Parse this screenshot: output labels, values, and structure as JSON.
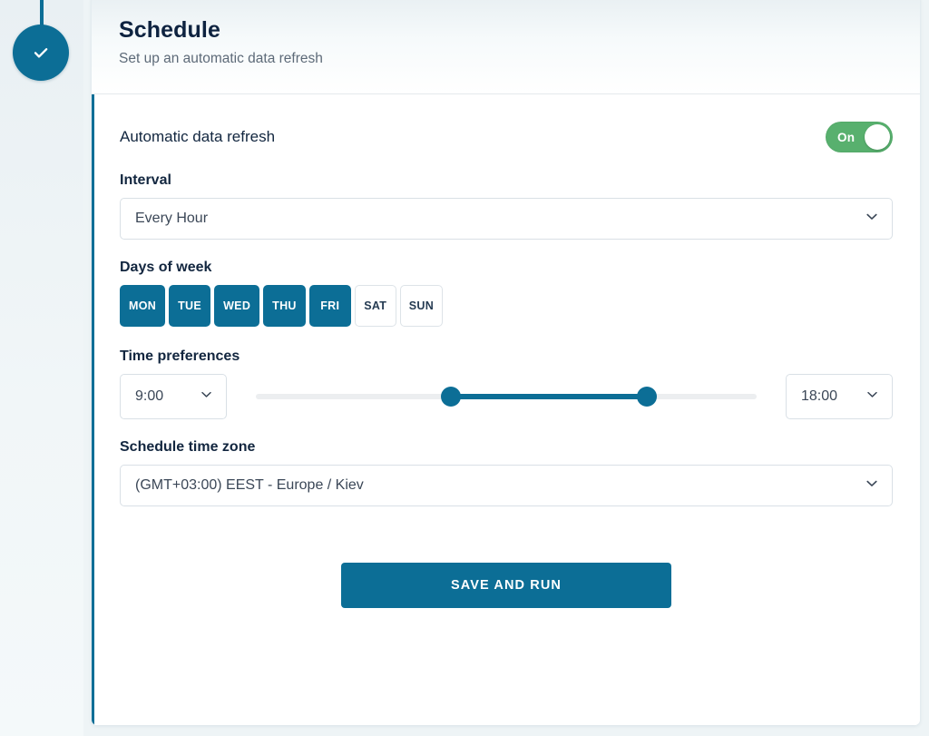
{
  "stepper": {
    "completed_icon": "check-icon",
    "accent_color": "#0c6e96"
  },
  "header": {
    "title": "Schedule",
    "subtitle": "Set up an automatic data refresh"
  },
  "auto_refresh": {
    "label": "Automatic data refresh",
    "toggle_state": "On",
    "enabled": true,
    "on_color": "#58b06e"
  },
  "interval": {
    "label": "Interval",
    "value": "Every Hour",
    "chevron_icon": "chevron-down-icon"
  },
  "days_of_week": {
    "label": "Days of week",
    "days": [
      {
        "label": "MON",
        "selected": true
      },
      {
        "label": "TUE",
        "selected": true
      },
      {
        "label": "WED",
        "selected": true
      },
      {
        "label": "THU",
        "selected": true
      },
      {
        "label": "FRI",
        "selected": true
      },
      {
        "label": "SAT",
        "selected": false
      },
      {
        "label": "SUN",
        "selected": false
      }
    ],
    "selected_color": "#0c6e96"
  },
  "time_preferences": {
    "label": "Time preferences",
    "start_time": "9:00",
    "end_time": "18:00",
    "slider": {
      "min_percent": 0,
      "max_percent": 100,
      "start_percent": 39,
      "end_percent": 78,
      "range_color": "#0c6e96",
      "track_color": "#eceef0"
    },
    "chevron_icon": "chevron-down-icon"
  },
  "timezone": {
    "label": "Schedule time zone",
    "value": "(GMT+03:00) EEST - Europe / Kiev",
    "chevron_icon": "chevron-down-icon"
  },
  "actions": {
    "save_label": "SAVE AND RUN"
  }
}
